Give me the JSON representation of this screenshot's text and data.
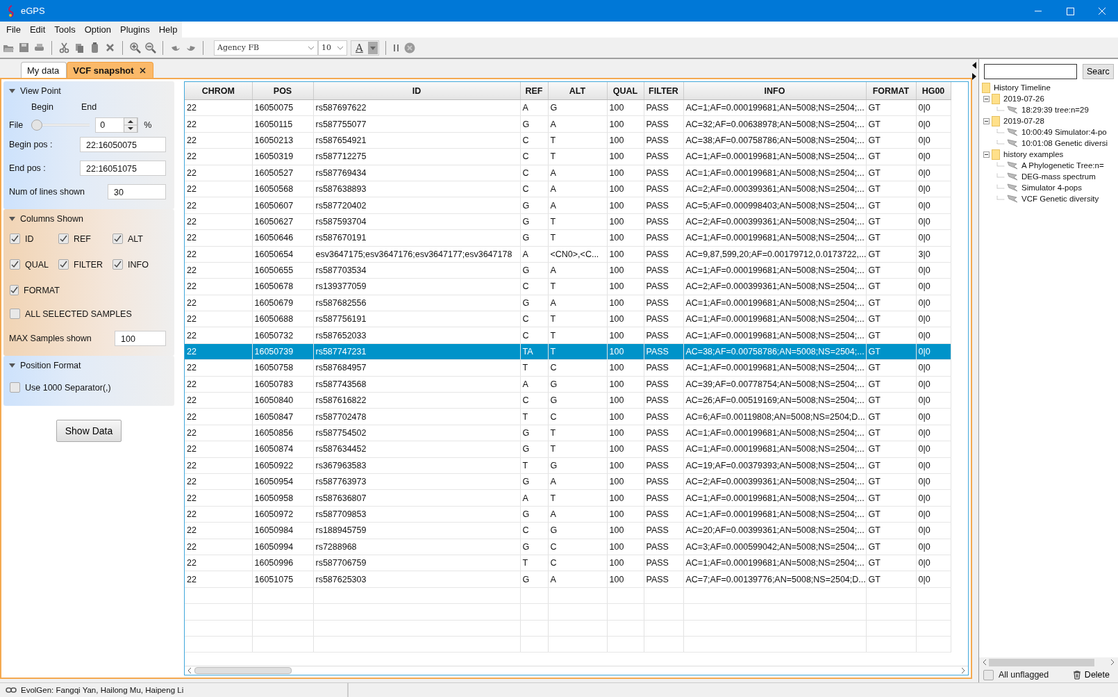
{
  "window": {
    "title": "eGPS"
  },
  "menu": [
    "File",
    "Edit",
    "Tools",
    "Option",
    "Plugins",
    "Help"
  ],
  "toolbar": {
    "font_combo": "Agency FB",
    "size_combo": "10",
    "font_color_button": "A"
  },
  "tabs": [
    {
      "label": "My data",
      "selected": false
    },
    {
      "label": "VCF snapshot",
      "selected": true
    }
  ],
  "view_point": {
    "title": "View Point",
    "expanded": true,
    "begin_label": "Begin",
    "end_label": "End",
    "file_label": "File",
    "slider": {
      "level": 0
    },
    "spinner": "0",
    "unit": "%",
    "fields": [
      {
        "label": "Begin pos :",
        "value": "22:16050075"
      },
      {
        "label": "End pos :",
        "value": "22:16051075"
      },
      {
        "label": "Num of lines shown",
        "value": "30"
      }
    ]
  },
  "columns_shown": {
    "title": "Columns Shown",
    "expanded": true,
    "checkboxes": [
      {
        "label": "ID",
        "checked": true
      },
      {
        "label": "REF",
        "checked": true
      },
      {
        "label": "ALT",
        "checked": true
      },
      {
        "label": "QUAL",
        "checked": true
      },
      {
        "label": "FILTER",
        "checked": true
      },
      {
        "label": "INFO",
        "checked": true
      },
      {
        "label": "FORMAT",
        "checked": true
      }
    ],
    "all_samples": {
      "label": "ALL SELECTED SAMPLES",
      "checked": false
    },
    "max_samples": {
      "label": "MAX Samples shown",
      "value": "100"
    }
  },
  "position_format": {
    "title": "Position Format",
    "expanded": true,
    "separator": {
      "label": "Use 1000 Separator(,)",
      "checked": false
    }
  },
  "show_data_button": "Show Data",
  "table": {
    "columns": [
      "CHROM",
      "POS",
      "ID",
      "REF",
      "ALT",
      "QUAL",
      "FILTER",
      "INFO",
      "FORMAT",
      "HG00"
    ],
    "rows": [
      {
        "selected": false,
        "cells": [
          "22",
          "16050075",
          "rs587697622",
          "A",
          "G",
          "100",
          "PASS",
          "AC=1;AF=0.000199681;AN=5008;NS=2504;...",
          "GT",
          "0|0"
        ]
      },
      {
        "selected": false,
        "cells": [
          "22",
          "16050115",
          "rs587755077",
          "G",
          "A",
          "100",
          "PASS",
          "AC=32;AF=0.00638978;AN=5008;NS=2504;...",
          "GT",
          "0|0"
        ]
      },
      {
        "selected": false,
        "cells": [
          "22",
          "16050213",
          "rs587654921",
          "C",
          "T",
          "100",
          "PASS",
          "AC=38;AF=0.00758786;AN=5008;NS=2504;...",
          "GT",
          "0|0"
        ]
      },
      {
        "selected": false,
        "cells": [
          "22",
          "16050319",
          "rs587712275",
          "C",
          "T",
          "100",
          "PASS",
          "AC=1;AF=0.000199681;AN=5008;NS=2504;...",
          "GT",
          "0|0"
        ]
      },
      {
        "selected": false,
        "cells": [
          "22",
          "16050527",
          "rs587769434",
          "C",
          "A",
          "100",
          "PASS",
          "AC=1;AF=0.000199681;AN=5008;NS=2504;...",
          "GT",
          "0|0"
        ]
      },
      {
        "selected": false,
        "cells": [
          "22",
          "16050568",
          "rs587638893",
          "C",
          "A",
          "100",
          "PASS",
          "AC=2;AF=0.000399361;AN=5008;NS=2504;...",
          "GT",
          "0|0"
        ]
      },
      {
        "selected": false,
        "cells": [
          "22",
          "16050607",
          "rs587720402",
          "G",
          "A",
          "100",
          "PASS",
          "AC=5;AF=0.000998403;AN=5008;NS=2504;...",
          "GT",
          "0|0"
        ]
      },
      {
        "selected": false,
        "cells": [
          "22",
          "16050627",
          "rs587593704",
          "G",
          "T",
          "100",
          "PASS",
          "AC=2;AF=0.000399361;AN=5008;NS=2504;...",
          "GT",
          "0|0"
        ]
      },
      {
        "selected": false,
        "cells": [
          "22",
          "16050646",
          "rs587670191",
          "G",
          "T",
          "100",
          "PASS",
          "AC=1;AF=0.000199681;AN=5008;NS=2504;...",
          "GT",
          "0|0"
        ]
      },
      {
        "selected": false,
        "cells": [
          "22",
          "16050654",
          "esv3647175;esv3647176;esv3647177;esv3647178",
          "A",
          "<CN0>,<C...",
          "100",
          "PASS",
          "AC=9,87,599,20;AF=0.00179712,0.0173722,...",
          "GT",
          "3|0"
        ]
      },
      {
        "selected": false,
        "cells": [
          "22",
          "16050655",
          "rs587703534",
          "G",
          "A",
          "100",
          "PASS",
          "AC=1;AF=0.000199681;AN=5008;NS=2504;...",
          "GT",
          "0|0"
        ]
      },
      {
        "selected": false,
        "cells": [
          "22",
          "16050678",
          "rs139377059",
          "C",
          "T",
          "100",
          "PASS",
          "AC=2;AF=0.000399361;AN=5008;NS=2504;...",
          "GT",
          "0|0"
        ]
      },
      {
        "selected": false,
        "cells": [
          "22",
          "16050679",
          "rs587682556",
          "G",
          "A",
          "100",
          "PASS",
          "AC=1;AF=0.000199681;AN=5008;NS=2504;...",
          "GT",
          "0|0"
        ]
      },
      {
        "selected": false,
        "cells": [
          "22",
          "16050688",
          "rs587756191",
          "C",
          "T",
          "100",
          "PASS",
          "AC=1;AF=0.000199681;AN=5008;NS=2504;...",
          "GT",
          "0|0"
        ]
      },
      {
        "selected": false,
        "cells": [
          "22",
          "16050732",
          "rs587652033",
          "C",
          "T",
          "100",
          "PASS",
          "AC=1;AF=0.000199681;AN=5008;NS=2504;...",
          "GT",
          "0|0"
        ]
      },
      {
        "selected": true,
        "cells": [
          "22",
          "16050739",
          "rs587747231",
          "TA",
          "T",
          "100",
          "PASS",
          "AC=38;AF=0.00758786;AN=5008;NS=2504;...",
          "GT",
          "0|0"
        ]
      },
      {
        "selected": false,
        "cells": [
          "22",
          "16050758",
          "rs587684957",
          "T",
          "C",
          "100",
          "PASS",
          "AC=1;AF=0.000199681;AN=5008;NS=2504;...",
          "GT",
          "0|0"
        ]
      },
      {
        "selected": false,
        "cells": [
          "22",
          "16050783",
          "rs587743568",
          "A",
          "G",
          "100",
          "PASS",
          "AC=39;AF=0.00778754;AN=5008;NS=2504;...",
          "GT",
          "0|0"
        ]
      },
      {
        "selected": false,
        "cells": [
          "22",
          "16050840",
          "rs587616822",
          "C",
          "G",
          "100",
          "PASS",
          "AC=26;AF=0.00519169;AN=5008;NS=2504;...",
          "GT",
          "0|0"
        ]
      },
      {
        "selected": false,
        "cells": [
          "22",
          "16050847",
          "rs587702478",
          "T",
          "C",
          "100",
          "PASS",
          "AC=6;AF=0.00119808;AN=5008;NS=2504;D...",
          "GT",
          "0|0"
        ]
      },
      {
        "selected": false,
        "cells": [
          "22",
          "16050856",
          "rs587754502",
          "G",
          "T",
          "100",
          "PASS",
          "AC=1;AF=0.000199681;AN=5008;NS=2504;...",
          "GT",
          "0|0"
        ]
      },
      {
        "selected": false,
        "cells": [
          "22",
          "16050874",
          "rs587634452",
          "G",
          "T",
          "100",
          "PASS",
          "AC=1;AF=0.000199681;AN=5008;NS=2504;...",
          "GT",
          "0|0"
        ]
      },
      {
        "selected": false,
        "cells": [
          "22",
          "16050922",
          "rs367963583",
          "T",
          "G",
          "100",
          "PASS",
          "AC=19;AF=0.00379393;AN=5008;NS=2504;...",
          "GT",
          "0|0"
        ]
      },
      {
        "selected": false,
        "cells": [
          "22",
          "16050954",
          "rs587763973",
          "G",
          "A",
          "100",
          "PASS",
          "AC=2;AF=0.000399361;AN=5008;NS=2504;...",
          "GT",
          "0|0"
        ]
      },
      {
        "selected": false,
        "cells": [
          "22",
          "16050958",
          "rs587636807",
          "A",
          "T",
          "100",
          "PASS",
          "AC=1;AF=0.000199681;AN=5008;NS=2504;...",
          "GT",
          "0|0"
        ]
      },
      {
        "selected": false,
        "cells": [
          "22",
          "16050972",
          "rs587709853",
          "G",
          "A",
          "100",
          "PASS",
          "AC=1;AF=0.000199681;AN=5008;NS=2504;...",
          "GT",
          "0|0"
        ]
      },
      {
        "selected": false,
        "cells": [
          "22",
          "16050984",
          "rs188945759",
          "C",
          "G",
          "100",
          "PASS",
          "AC=20;AF=0.00399361;AN=5008;NS=2504;...",
          "GT",
          "0|0"
        ]
      },
      {
        "selected": false,
        "cells": [
          "22",
          "16050994",
          "rs7288968",
          "G",
          "C",
          "100",
          "PASS",
          "AC=3;AF=0.000599042;AN=5008;NS=2504;...",
          "GT",
          "0|0"
        ]
      },
      {
        "selected": false,
        "cells": [
          "22",
          "16050996",
          "rs587706759",
          "T",
          "C",
          "100",
          "PASS",
          "AC=1;AF=0.000199681;AN=5008;NS=2504;...",
          "GT",
          "0|0"
        ]
      },
      {
        "selected": false,
        "cells": [
          "22",
          "16051075",
          "rs587625303",
          "G",
          "A",
          "100",
          "PASS",
          "AC=7;AF=0.00139776;AN=5008;NS=2504;D...",
          "GT",
          "0|0"
        ]
      }
    ]
  },
  "history": {
    "search_button": "Searc",
    "tree": [
      {
        "label": "History Timeline",
        "kind": "folder",
        "children": [
          {
            "label": "2019-07-26",
            "kind": "folder",
            "expanded": true,
            "children": [
              {
                "label": "18:29:39 tree:n=29",
                "kind": "leaf"
              }
            ]
          },
          {
            "label": "2019-07-28",
            "kind": "folder",
            "expanded": true,
            "children": [
              {
                "label": "10:00:49 Simulator:4-po",
                "kind": "leaf"
              },
              {
                "label": "10:01:08 Genetic diversi",
                "kind": "leaf"
              }
            ]
          },
          {
            "label": "history examples",
            "kind": "folder",
            "expanded": true,
            "children": [
              {
                "label": "A Phylogenetic Tree:n=",
                "kind": "leaf"
              },
              {
                "label": "DEG-mass spectrum",
                "kind": "leaf"
              },
              {
                "label": "Simulator 4-pops",
                "kind": "leaf"
              },
              {
                "label": "VCF Genetic diversity",
                "kind": "leaf"
              }
            ]
          }
        ]
      }
    ],
    "all_unflagged": {
      "label": "All unflagged",
      "checked": false
    },
    "delete_button": "Delete"
  },
  "status_bar": {
    "text": "EvolGen:  Fangqi Yan, Hailong Mu, Haipeng Li"
  }
}
